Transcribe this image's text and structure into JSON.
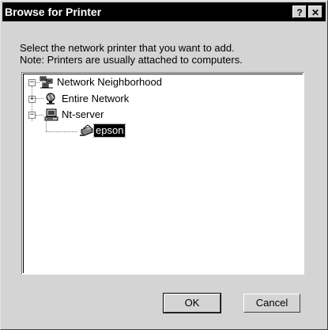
{
  "window": {
    "title": "Browse for Printer",
    "help_glyph": "?",
    "close_glyph": "✕"
  },
  "instructions": {
    "line1": "Select the network printer that you want to add.",
    "line2": "Note: Printers are usually attached to computers."
  },
  "tree": {
    "nodes": [
      {
        "label": "Network Neighborhood",
        "icon": "network-neighborhood-icon",
        "expander": "−"
      },
      {
        "label": "Entire Network",
        "icon": "globe-icon",
        "expander": "+"
      },
      {
        "label": "Nt-server",
        "icon": "computer-icon",
        "expander": "−"
      },
      {
        "label": "epson",
        "icon": "printer-icon",
        "selected": true
      }
    ]
  },
  "buttons": {
    "ok": "OK",
    "cancel": "Cancel"
  }
}
